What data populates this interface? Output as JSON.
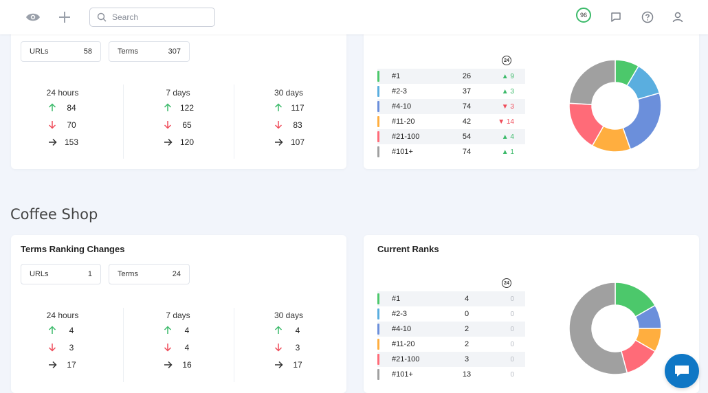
{
  "topbar": {
    "search_placeholder": "Search",
    "score": "96"
  },
  "colors": {
    "rank_1": "#4cc86b",
    "rank_2_3": "#5aaedf",
    "rank_4_10": "#6b8fdb",
    "rank_11_20": "#ffae3f",
    "rank_21_100": "#ff6b78",
    "rank_101_plus": "#a0a0a0",
    "up": "#3cba6a",
    "down": "#ef4c5a",
    "accent": "#0f77c5"
  },
  "project1": {
    "changes": {
      "title": "",
      "urls_label": "URLs",
      "urls_value": "58",
      "terms_label": "Terms",
      "terms_value": "307",
      "periods": [
        {
          "label": "24 hours",
          "up": "84",
          "down": "70",
          "same": "153"
        },
        {
          "label": "7 days",
          "up": "122",
          "down": "65",
          "same": "120"
        },
        {
          "label": "30 days",
          "up": "117",
          "down": "83",
          "same": "107"
        }
      ]
    },
    "ranks": {
      "title": "",
      "badge": "24",
      "rows": [
        {
          "label": "#1",
          "count": "26",
          "change": "▲ 9",
          "dir": "up"
        },
        {
          "label": "#2-3",
          "count": "37",
          "change": "▲ 3",
          "dir": "up"
        },
        {
          "label": "#4-10",
          "count": "74",
          "change": "▼ 3",
          "dir": "down"
        },
        {
          "label": "#11-20",
          "count": "42",
          "change": "▼ 14",
          "dir": "down"
        },
        {
          "label": "#21-100",
          "count": "54",
          "change": "▲ 4",
          "dir": "up"
        },
        {
          "label": "#101+",
          "count": "74",
          "change": "▲ 1",
          "dir": "up"
        }
      ]
    }
  },
  "project2": {
    "name": "Coffee Shop",
    "changes": {
      "title": "Terms Ranking Changes",
      "urls_label": "URLs",
      "urls_value": "1",
      "terms_label": "Terms",
      "terms_value": "24",
      "periods": [
        {
          "label": "24 hours",
          "up": "4",
          "down": "3",
          "same": "17"
        },
        {
          "label": "7 days",
          "up": "4",
          "down": "4",
          "same": "16"
        },
        {
          "label": "30 days",
          "up": "4",
          "down": "3",
          "same": "17"
        }
      ]
    },
    "ranks": {
      "title": "Current Ranks",
      "badge": "24",
      "rows": [
        {
          "label": "#1",
          "count": "4",
          "change": "0",
          "dir": "zero"
        },
        {
          "label": "#2-3",
          "count": "0",
          "change": "0",
          "dir": "zero"
        },
        {
          "label": "#4-10",
          "count": "2",
          "change": "0",
          "dir": "zero"
        },
        {
          "label": "#11-20",
          "count": "2",
          "change": "0",
          "dir": "zero"
        },
        {
          "label": "#21-100",
          "count": "3",
          "change": "0",
          "dir": "zero"
        },
        {
          "label": "#101+",
          "count": "13",
          "change": "0",
          "dir": "zero"
        }
      ]
    }
  },
  "chart_data": [
    {
      "type": "pie",
      "categories": [
        "#1",
        "#2-3",
        "#4-10",
        "#11-20",
        "#21-100",
        "#101+"
      ],
      "values": [
        26,
        37,
        74,
        42,
        54,
        74
      ],
      "donut": true
    },
    {
      "type": "pie",
      "categories": [
        "#1",
        "#2-3",
        "#4-10",
        "#11-20",
        "#21-100",
        "#101+"
      ],
      "values": [
        4,
        0,
        2,
        2,
        3,
        13
      ],
      "donut": true
    }
  ]
}
